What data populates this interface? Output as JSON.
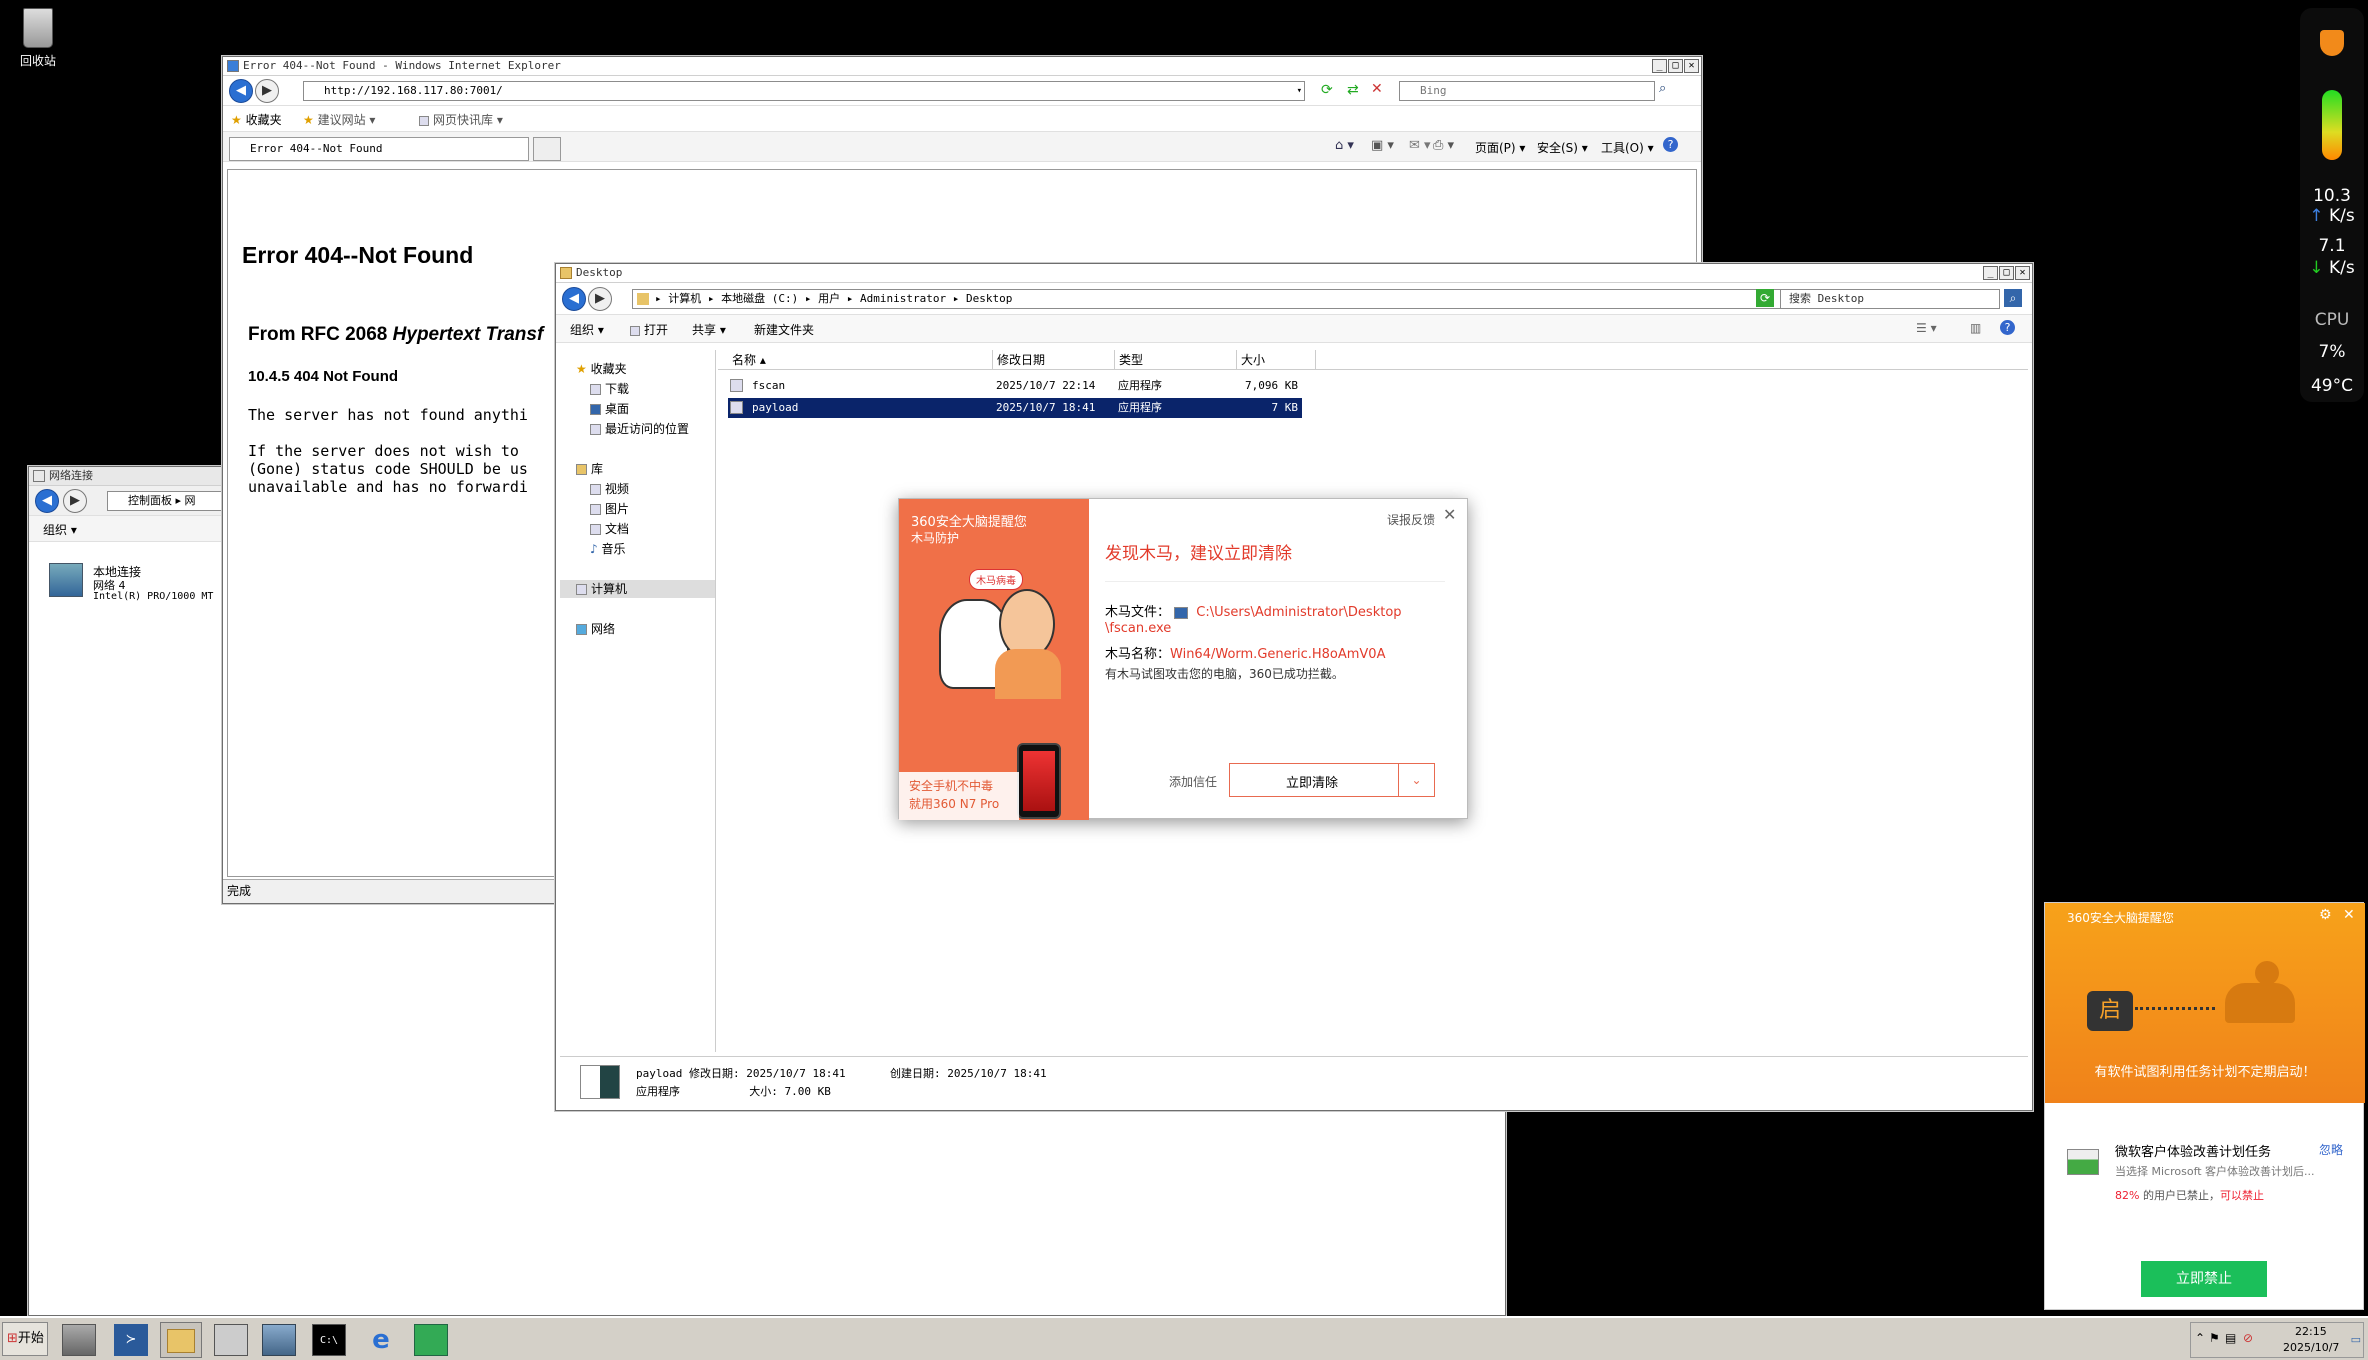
{
  "desktop": {
    "recycle_label": "回收站"
  },
  "ie": {
    "title": "Error 404--Not Found - Windows Internet Explorer",
    "url": "http://192.168.117.80:7001/",
    "search_placeholder": "Bing",
    "favorites": "收藏夹",
    "suggested": "建议网站",
    "webslice": "网页快讯库",
    "tab": "Error 404--Not Found",
    "page_menu": "页面(P)",
    "safety_menu": "安全(S)",
    "tools_menu": "工具(O)",
    "heading": "Error 404--Not Found",
    "rfc_prefix": "From RFC 2068 ",
    "rfc_italic": "Hypertext Transf",
    "sub": "10.4.5 404 Not Found",
    "para1": "The server has not found anythi",
    "para2a": "If the server does not wish to",
    "para2b": "(Gone) status code SHOULD be us",
    "para2c": "unavailable and has no forwardi",
    "status": "完成"
  },
  "netconn": {
    "title": "网络连接",
    "crumb": "控制面板 ▸ 网",
    "organize": "组织",
    "item_name": "本地连接",
    "item_net": "网络  4",
    "item_dev": "Intel(R) PRO/1000 MT"
  },
  "explorer": {
    "title": "Desktop",
    "crumbs": [
      "计算机",
      "本地磁盘 (C:)",
      "用户",
      "Administrator",
      "Desktop"
    ],
    "search": "搜索 Desktop",
    "toolbar": {
      "organize": "组织",
      "open": "打开",
      "share": "共享",
      "new_folder": "新建文件夹"
    },
    "nav": {
      "favorites": "收藏夹",
      "downloads": "下载",
      "desktop": "桌面",
      "recent": "最近访问的位置",
      "libraries": "库",
      "videos": "视频",
      "pictures": "图片",
      "documents": "文档",
      "music": "音乐",
      "computer": "计算机",
      "network": "网络"
    },
    "columns": {
      "name": "名称",
      "modified": "修改日期",
      "type": "类型",
      "size": "大小"
    },
    "files": [
      {
        "name": "fscan",
        "modified": "2025/10/7 22:14",
        "type": "应用程序",
        "size": "7,096 KB"
      },
      {
        "name": "payload",
        "modified": "2025/10/7 18:41",
        "type": "应用程序",
        "size": "7 KB"
      }
    ],
    "details": {
      "name": "payload",
      "mod_label": "修改日期:",
      "mod_val": "2025/10/7 18:41",
      "created_label": "创建日期:",
      "created_val": "2025/10/7 18:41",
      "type": "应用程序",
      "size_label": "大小:",
      "size_val": "7.00 KB"
    }
  },
  "alert360": {
    "brand": "360安全大脑提醒您",
    "subtitle": "木马防护",
    "badge": "木马病毒",
    "promo1": "安全手机不中毒",
    "promo2": "就用360 N7 Pro",
    "feedback": "误报反馈",
    "headline": "发现木马，建议立即清除",
    "file_label": "木马文件：",
    "file_path1": "C:\\Users\\Administrator\\Desktop",
    "file_path2": "\\fscan.exe",
    "name_label": "木马名称：",
    "name_val": "Win64/Worm.Generic.H8oAmV0A",
    "note": "有木马试图攻击您的电脑，360已成功拦截。",
    "trust": "添加信任",
    "clean": "立即清除"
  },
  "side360": {
    "speed_up": "10.3",
    "speed_up_unit": "K/s",
    "speed_down": "7.1",
    "speed_down_unit": "K/s",
    "cpu_label": "CPU",
    "cpu_val": "7%",
    "temp": "49°C"
  },
  "popup360": {
    "header": "360安全大脑提醒您",
    "lock_char": "启",
    "banner": "有软件试图利用任务计划不定期启动！",
    "item_title": "微软客户体验改善计划任务",
    "ignore": "忽略",
    "desc": "当选择 Microsoft 客户体验改善计划后...",
    "pct": "82%",
    "pct_rest": " 的用户已禁止，",
    "can": "可以禁止",
    "button": "立即禁止"
  },
  "taskbar": {
    "start": "开始",
    "time": "22:15",
    "date": "2025/10/7"
  }
}
